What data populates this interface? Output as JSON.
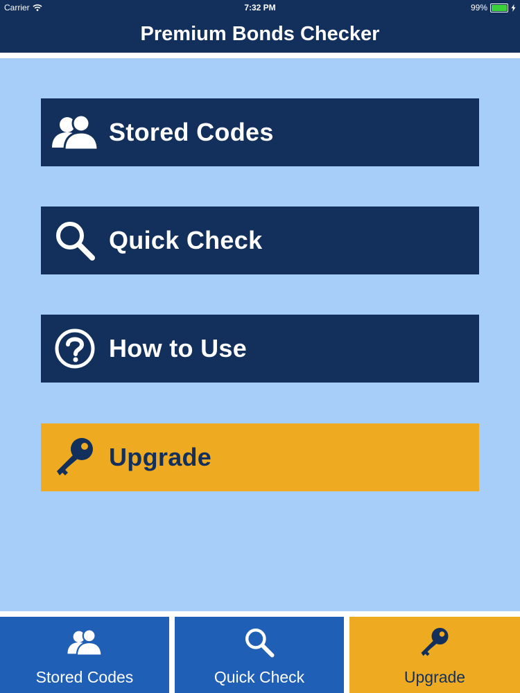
{
  "status_bar": {
    "carrier": "Carrier",
    "time": "7:32 PM",
    "battery_percent": "99%",
    "battery_level": 0.99,
    "wifi_icon": "wifi-icon",
    "charging_icon": "bolt-icon"
  },
  "nav": {
    "title": "Premium Bonds Checker"
  },
  "menu": {
    "items": [
      {
        "label": "Stored Codes",
        "icon": "users-icon"
      },
      {
        "label": "Quick Check",
        "icon": "magnifier-icon"
      },
      {
        "label": "How to Use",
        "icon": "question-circle-icon"
      },
      {
        "label": "Upgrade",
        "icon": "key-icon"
      }
    ]
  },
  "tabs": {
    "items": [
      {
        "label": "Stored Codes",
        "icon": "users-icon"
      },
      {
        "label": "Quick Check",
        "icon": "magnifier-icon"
      },
      {
        "label": "Upgrade",
        "icon": "key-icon",
        "active": true
      }
    ]
  },
  "colors": {
    "navy": "#12305b",
    "light_blue": "#a7cdf9",
    "tab_blue": "#1f5fb5",
    "gold": "#eeab22"
  }
}
